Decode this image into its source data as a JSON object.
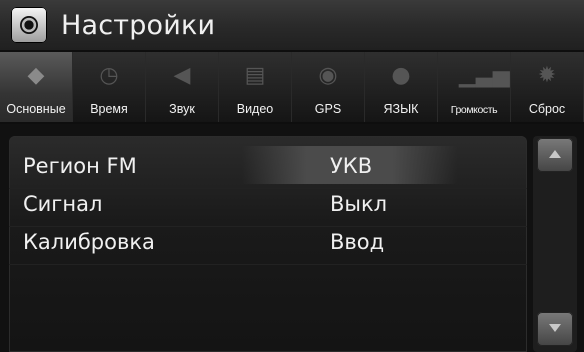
{
  "header": {
    "title": "Настройки",
    "icon": "settings-app-icon"
  },
  "tabs": [
    {
      "label": "Основные",
      "icon": "cube-icon",
      "glyph": "◆",
      "active": true
    },
    {
      "label": "Время",
      "icon": "clock-icon",
      "glyph": "◷",
      "active": false
    },
    {
      "label": "Звук",
      "icon": "speaker-icon",
      "glyph": "◀",
      "active": false
    },
    {
      "label": "Видео",
      "icon": "film-icon",
      "glyph": "▤",
      "active": false
    },
    {
      "label": "GPS",
      "icon": "gps-icon",
      "glyph": "◉",
      "active": false
    },
    {
      "label": "ЯЗЫК",
      "icon": "speech-bubble-icon",
      "glyph": "●",
      "active": false
    },
    {
      "label": "Громкость",
      "icon": "volume-bars-icon",
      "glyph": "▁▃▅",
      "active": false
    },
    {
      "label": "Сброс",
      "icon": "gear-icon",
      "glyph": "✹",
      "active": false
    }
  ],
  "settings": [
    {
      "label": "Регион FM",
      "value": "УКВ",
      "selected": true
    },
    {
      "label": "Сигнал",
      "value": "Выкл",
      "selected": false
    },
    {
      "label": "Калибровка",
      "value": "Ввод",
      "selected": false
    }
  ],
  "scrollbar": {
    "up_icon": "arrow-up-icon",
    "down_icon": "arrow-down-icon"
  },
  "colors": {
    "background": "#0e0e0e",
    "text": "#f0f0f0",
    "highlight": "#4b4b4b"
  }
}
